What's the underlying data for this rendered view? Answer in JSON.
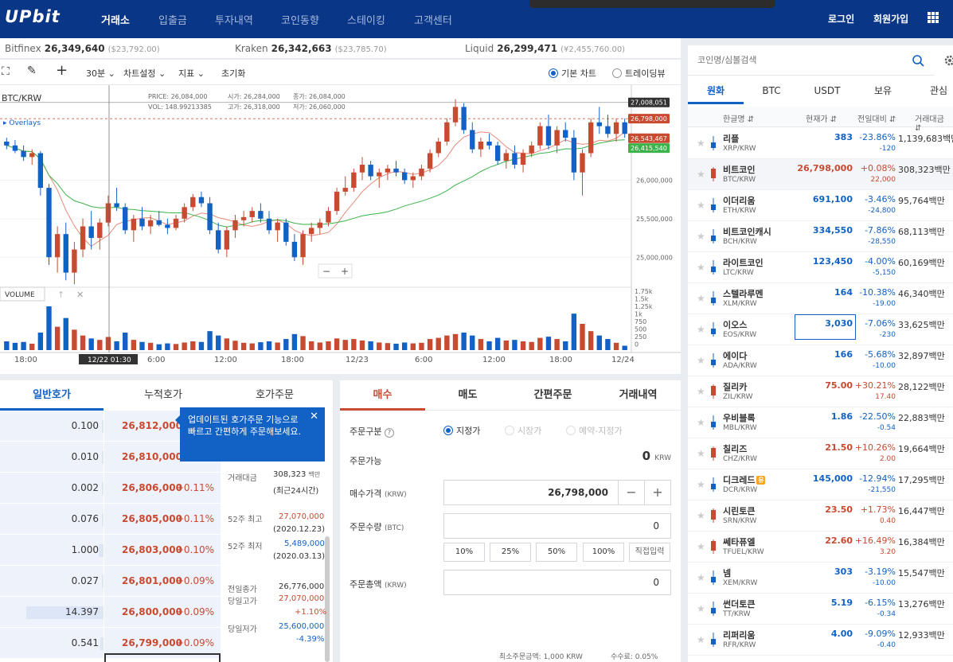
{
  "nav": {
    "logo": "UPbit",
    "items": [
      "거래소",
      "입출금",
      "투자내역",
      "코인동향",
      "스테이킹",
      "고객센터"
    ],
    "login": "로그인",
    "signup": "회원가입"
  },
  "ticker": [
    {
      "exchange": "Bitfinex",
      "price": "26,349,640",
      "usd": "($23,792.00)"
    },
    {
      "exchange": "Kraken",
      "price": "26,342,663",
      "usd": "($23,785.70)"
    },
    {
      "exchange": "Liquid",
      "price": "26,299,471",
      "usd": "(¥2,455,760.00)"
    }
  ],
  "chart_toolbar": {
    "interval": "30분",
    "settings": "차트설정",
    "indicator": "지표",
    "reset": "초기화",
    "basic_chart": "기본 차트",
    "tradingview": "트레이딩뷰"
  },
  "chart_data": {
    "type": "candlestick",
    "symbol": "BTC/KRW",
    "overlays_label": "Overlays",
    "volume_label": "VOLUME",
    "ohlc_info": {
      "price_label": "PRICE:",
      "price": "26,084,000",
      "vol_label": "VOL:",
      "vol": "148.99213385",
      "open_label": "시가:",
      "open": "26,284,000",
      "high_label": "고가:",
      "high": "26,318,000",
      "close_label": "종가:",
      "close": "26,084,000",
      "low_label": "저가:",
      "low": "26,060,000"
    },
    "y_ticks": [
      25000000,
      25500000,
      26000000
    ],
    "y_tick_labels": [
      "25,000,000",
      "25,500,000",
      "26,000,000"
    ],
    "y_range": [
      24600000,
      27150000
    ],
    "price_tags": [
      {
        "label": "27,008,051",
        "value": 27008051,
        "color": "#333333"
      },
      {
        "label": "26,798,000",
        "value": 26798000,
        "color": "#c84a31"
      },
      {
        "label": "26,543,467",
        "value": 26543467,
        "color": "#c84a31"
      },
      {
        "label": "26,415,540",
        "value": 26415540,
        "color": "#3cb34a"
      }
    ],
    "vol_ticks": [
      "1.75k",
      "1.5k",
      "1.25k",
      "1k",
      "750",
      "500",
      "250",
      "0"
    ],
    "vol_range": [
      0,
      1800
    ],
    "x_labels": [
      "18:00",
      "12/22",
      "6:00",
      "12:00",
      "18:00",
      "12/23",
      "6:00",
      "12:00",
      "18:00",
      "12/24"
    ],
    "crosshair_label": "12/22 01:30",
    "zoom_minus": "−",
    "zoom_plus": "+",
    "candles": [
      [
        26500000,
        26550000,
        26400000,
        26450000,
        300
      ],
      [
        26450000,
        26520000,
        26350000,
        26380000,
        250
      ],
      [
        26380000,
        26450000,
        26250000,
        26300000,
        280
      ],
      [
        26300000,
        26400000,
        26200000,
        26350000,
        220
      ],
      [
        26350000,
        26380000,
        25800000,
        25900000,
        600
      ],
      [
        25900000,
        25950000,
        24900000,
        25000000,
        1500
      ],
      [
        25000000,
        25400000,
        24800000,
        25300000,
        800
      ],
      [
        25300000,
        25450000,
        24700000,
        24800000,
        1100
      ],
      [
        24800000,
        25200000,
        24650000,
        25100000,
        700
      ],
      [
        25100000,
        25500000,
        25000000,
        25400000,
        500
      ],
      [
        25400000,
        25600000,
        25100000,
        25250000,
        400
      ],
      [
        25250000,
        25500000,
        25100000,
        25450000,
        350
      ],
      [
        25450000,
        25800000,
        25400000,
        25700000,
        450
      ],
      [
        25700000,
        25900000,
        25600000,
        25650000,
        300
      ],
      [
        25650000,
        25700000,
        25300000,
        25350000,
        600
      ],
      [
        25350000,
        25550000,
        25200000,
        25500000,
        350
      ],
      [
        25500000,
        25650000,
        25350000,
        25400000,
        280
      ],
      [
        25400000,
        25550000,
        25300000,
        25480000,
        250
      ],
      [
        25480000,
        25600000,
        25400000,
        25420000,
        200
      ],
      [
        25420000,
        25500000,
        25300000,
        25380000,
        230
      ],
      [
        25380000,
        25550000,
        25350000,
        25500000,
        210
      ],
      [
        25500000,
        25700000,
        25450000,
        25650000,
        260
      ],
      [
        25650000,
        25820000,
        25600000,
        25780000,
        300
      ],
      [
        25780000,
        25850000,
        25650000,
        25700000,
        280
      ],
      [
        25700000,
        25780000,
        25300000,
        25350000,
        650
      ],
      [
        25350000,
        25450000,
        25050000,
        25100000,
        500
      ],
      [
        25100000,
        25400000,
        25000000,
        25350000,
        400
      ],
      [
        25350000,
        25550000,
        25250000,
        25480000,
        320
      ],
      [
        25480000,
        25600000,
        25400000,
        25520000,
        250
      ],
      [
        25520000,
        25650000,
        25450000,
        25600000,
        230
      ],
      [
        25600000,
        25700000,
        25450000,
        25500000,
        270
      ],
      [
        25500000,
        25600000,
        25300000,
        25350000,
        300
      ],
      [
        25350000,
        25500000,
        25200000,
        25450000,
        260
      ],
      [
        25450000,
        25500000,
        25150000,
        25200000,
        380
      ],
      [
        25200000,
        25300000,
        24950000,
        25000000,
        550
      ],
      [
        25000000,
        25350000,
        24900000,
        25300000,
        480
      ],
      [
        25300000,
        25450000,
        25200000,
        25380000,
        300
      ],
      [
        25380000,
        25500000,
        25300000,
        25450000,
        260
      ],
      [
        25450000,
        25650000,
        25400000,
        25600000,
        300
      ],
      [
        25600000,
        25900000,
        25550000,
        25850000,
        400
      ],
      [
        25850000,
        26050000,
        25800000,
        25900000,
        350
      ],
      [
        25900000,
        26150000,
        25850000,
        26100000,
        380
      ],
      [
        26100000,
        26300000,
        26000000,
        26200000,
        330
      ],
      [
        26200000,
        26250000,
        26000000,
        26050000,
        300
      ],
      [
        26050000,
        26150000,
        25900000,
        26100000,
        260
      ],
      [
        26100000,
        26200000,
        26000000,
        26150000,
        240
      ],
      [
        26150000,
        26250000,
        26050000,
        26100000,
        220
      ],
      [
        26100000,
        26150000,
        25950000,
        26000000,
        260
      ],
      [
        26000000,
        26100000,
        25900000,
        26050000,
        230
      ],
      [
        26050000,
        26200000,
        26000000,
        26150000,
        250
      ],
      [
        26150000,
        26400000,
        26100000,
        26350000,
        380
      ],
      [
        26350000,
        26550000,
        26300000,
        26500000,
        420
      ],
      [
        26500000,
        26800000,
        26450000,
        26750000,
        500
      ],
      [
        26750000,
        27050000,
        26700000,
        26950000,
        550
      ],
      [
        26950000,
        27000000,
        26600000,
        26650000,
        600
      ],
      [
        26650000,
        26750000,
        26350000,
        26400000,
        500
      ],
      [
        26400000,
        26550000,
        26300000,
        26500000,
        380
      ],
      [
        26500000,
        26600000,
        26400000,
        26450000,
        300
      ],
      [
        26450000,
        26500000,
        26200000,
        26250000,
        420
      ],
      [
        26250000,
        26400000,
        26150000,
        26350000,
        330
      ],
      [
        26350000,
        26450000,
        26150000,
        26200000,
        350
      ],
      [
        26200000,
        26400000,
        26100000,
        26350000,
        300
      ],
      [
        26350000,
        26500000,
        26300000,
        26450000,
        280
      ],
      [
        26450000,
        26750000,
        26400000,
        26700000,
        420
      ],
      [
        26700000,
        26850000,
        26400000,
        26450000,
        460
      ],
      [
        26450000,
        26700000,
        26350000,
        26650000,
        380
      ],
      [
        26650000,
        26750000,
        26500000,
        26550000,
        300
      ],
      [
        26550000,
        26650000,
        26000000,
        26100000,
        1250
      ],
      [
        26100000,
        26400000,
        25800000,
        26350000,
        900
      ],
      [
        26350000,
        26800000,
        26300000,
        26750000,
        650
      ],
      [
        26750000,
        26950000,
        26600000,
        26700000,
        500
      ],
      [
        26700000,
        26850000,
        26550000,
        26600000,
        380
      ],
      [
        26600000,
        26800000,
        26500000,
        26750000,
        250
      ],
      [
        26750000,
        26800000,
        26550000,
        26600000,
        150
      ]
    ]
  },
  "orderbook": {
    "tabs": [
      "일반호가",
      "누적호가",
      "호가주문"
    ],
    "rows": [
      {
        "qty": "0.100",
        "price": "26,812,000",
        "change": "",
        "bar": 0.01
      },
      {
        "qty": "0.010",
        "price": "26,810,000",
        "change": "",
        "bar": 0.01
      },
      {
        "qty": "0.002",
        "price": "26,806,000",
        "change": "+0.11%",
        "bar": 0.01
      },
      {
        "qty": "0.076",
        "price": "26,805,000",
        "change": "+0.11%",
        "bar": 0.01
      },
      {
        "qty": "1.000",
        "price": "26,803,000",
        "change": "+0.10%",
        "bar": 0.05
      },
      {
        "qty": "0.027",
        "price": "26,801,000",
        "change": "+0.09%",
        "bar": 0.01
      },
      {
        "qty": "14.397",
        "price": "26,800,000",
        "change": "+0.09%",
        "bar": 0.75
      },
      {
        "qty": "0.541",
        "price": "26,799,000",
        "change": "+0.09%",
        "bar": 0.03
      }
    ],
    "tooltip": "업데이트된 호가주문 기능으로 빠르고 간편하게 주문해보세요.",
    "tooltip_close": "✕",
    "info": {
      "trade_value_label": "거래대금",
      "trade_value": "308,323",
      "trade_value_unit": "백만",
      "trade_value_period": "(최근24시간)",
      "high52_label": "52주 최고",
      "high52": "27,070,000",
      "high52_date": "(2020.12.23)",
      "low52_label": "52주 최저",
      "low52": "5,489,000",
      "low52_date": "(2020.03.13)",
      "prev_close_label": "전일종가",
      "prev_close": "26,776,000",
      "day_high_label": "당일고가",
      "day_high": "27,070,000",
      "day_high_pct": "+1.10%",
      "day_low_label": "당일저가",
      "day_low": "25,600,000",
      "day_low_pct": "-4.39%"
    }
  },
  "order": {
    "tabs": [
      "매수",
      "매도",
      "간편주문",
      "거래내역"
    ],
    "type_label": "주문구분",
    "help_icon": "?",
    "types": [
      "지정가",
      "시장가",
      "예약-지정가"
    ],
    "available_label": "주문가능",
    "available_value": "0",
    "available_unit": "KRW",
    "price_label": "매수가격",
    "price_unit": "(KRW)",
    "price_value": "26,798,000",
    "minus": "−",
    "plus": "+",
    "qty_label": "주문수량",
    "qty_unit": "(BTC)",
    "qty_value": "0",
    "pct_buttons": [
      "10%",
      "25%",
      "50%",
      "100%",
      "직접입력"
    ],
    "total_label": "주문총액",
    "total_unit": "(KRW)",
    "total_value": "0",
    "min_order": "최소주문금액: 1,000 KRW",
    "fee": "수수료: 0.05%"
  },
  "market": {
    "search_placeholder": "코인명/심볼검색",
    "tabs": [
      "원화",
      "BTC",
      "USDT",
      "보유",
      "관심"
    ],
    "headers": {
      "name": "한글명 ⇵",
      "price": "현재가 ⇵",
      "change": "전일대비 ⇵",
      "volume": "거래대금 ⇵"
    },
    "coins": [
      {
        "name": "리플",
        "sym": "XRP/KRW",
        "price": "383",
        "pct": "-23.86%",
        "diff": "-120",
        "vol": "1,139,683백만",
        "dir": "dn"
      },
      {
        "name": "비트코인",
        "sym": "BTC/KRW",
        "price": "26,798,000",
        "pct": "+0.08%",
        "diff": "22,000",
        "vol": "308,323백만",
        "dir": "up"
      },
      {
        "name": "이더리움",
        "sym": "ETH/KRW",
        "price": "691,100",
        "pct": "-3.46%",
        "diff": "-24,800",
        "vol": "95,764백만",
        "dir": "dn"
      },
      {
        "name": "비트코인캐시",
        "sym": "BCH/KRW",
        "price": "334,550",
        "pct": "-7.86%",
        "diff": "-28,550",
        "vol": "68,113백만",
        "dir": "dn"
      },
      {
        "name": "라이트코인",
        "sym": "LTC/KRW",
        "price": "123,450",
        "pct": "-4.00%",
        "diff": "-5,150",
        "vol": "60,169백만",
        "dir": "dn"
      },
      {
        "name": "스텔라루멘",
        "sym": "XLM/KRW",
        "price": "164",
        "pct": "-10.38%",
        "diff": "-19.00",
        "vol": "46,340백만",
        "dir": "dn"
      },
      {
        "name": "이오스",
        "sym": "EOS/KRW",
        "price": "3,030",
        "pct": "-7.06%",
        "diff": "-230",
        "vol": "33,625백만",
        "dir": "dn"
      },
      {
        "name": "에이다",
        "sym": "ADA/KRW",
        "price": "166",
        "pct": "-5.68%",
        "diff": "-10.00",
        "vol": "32,897백만",
        "dir": "dn"
      },
      {
        "name": "질리카",
        "sym": "ZIL/KRW",
        "price": "75.00",
        "pct": "+30.21%",
        "diff": "17.40",
        "vol": "28,122백만",
        "dir": "up"
      },
      {
        "name": "우비블록",
        "sym": "MBL/KRW",
        "price": "1.86",
        "pct": "-22.50%",
        "diff": "-0.54",
        "vol": "22,883백만",
        "dir": "dn"
      },
      {
        "name": "칠리즈",
        "sym": "CHZ/KRW",
        "price": "21.50",
        "pct": "+10.26%",
        "diff": "2.00",
        "vol": "19,664백만",
        "dir": "up"
      },
      {
        "name": "디크레드",
        "sym": "DCR/KRW",
        "price": "145,000",
        "pct": "-12.94%",
        "diff": "-21,550",
        "vol": "17,295백만",
        "dir": "dn",
        "badge": "유"
      },
      {
        "name": "시린토큰",
        "sym": "SRN/KRW",
        "price": "23.50",
        "pct": "+1.73%",
        "diff": "0.40",
        "vol": "16,447백만",
        "dir": "up"
      },
      {
        "name": "쎄타퓨엘",
        "sym": "TFUEL/KRW",
        "price": "22.60",
        "pct": "+16.49%",
        "diff": "3.20",
        "vol": "16,384백만",
        "dir": "up"
      },
      {
        "name": "넴",
        "sym": "XEM/KRW",
        "price": "303",
        "pct": "-3.19%",
        "diff": "-10.00",
        "vol": "15,547백만",
        "dir": "dn"
      },
      {
        "name": "썬더토큰",
        "sym": "TT/KRW",
        "price": "5.19",
        "pct": "-6.15%",
        "diff": "-0.34",
        "vol": "13,276백만",
        "dir": "dn"
      },
      {
        "name": "리퍼리움",
        "sym": "RFR/KRW",
        "price": "4.00",
        "pct": "-9.09%",
        "diff": "-0.40",
        "vol": "12,933백만",
        "dir": "dn"
      }
    ]
  },
  "colors": {
    "brand": "#093687",
    "up": "#c84a31",
    "down": "#1261c4",
    "ma_long": "#3cb34a",
    "ma_short": "#e88a7a"
  }
}
